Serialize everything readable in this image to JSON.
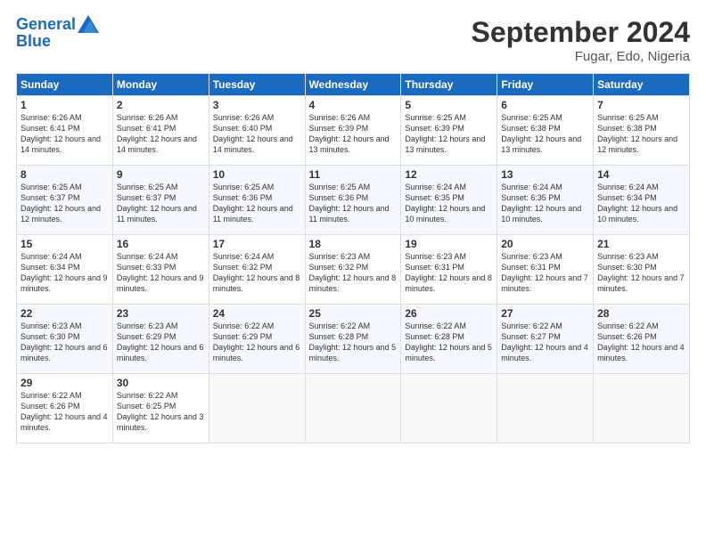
{
  "header": {
    "logo_line1": "General",
    "logo_line2": "Blue",
    "month": "September 2024",
    "location": "Fugar, Edo, Nigeria"
  },
  "weekdays": [
    "Sunday",
    "Monday",
    "Tuesday",
    "Wednesday",
    "Thursday",
    "Friday",
    "Saturday"
  ],
  "weeks": [
    [
      {
        "day": "1",
        "sunrise": "6:26 AM",
        "sunset": "6:41 PM",
        "daylight": "12 hours and 14 minutes."
      },
      {
        "day": "2",
        "sunrise": "6:26 AM",
        "sunset": "6:41 PM",
        "daylight": "12 hours and 14 minutes."
      },
      {
        "day": "3",
        "sunrise": "6:26 AM",
        "sunset": "6:40 PM",
        "daylight": "12 hours and 14 minutes."
      },
      {
        "day": "4",
        "sunrise": "6:26 AM",
        "sunset": "6:39 PM",
        "daylight": "12 hours and 13 minutes."
      },
      {
        "day": "5",
        "sunrise": "6:25 AM",
        "sunset": "6:39 PM",
        "daylight": "12 hours and 13 minutes."
      },
      {
        "day": "6",
        "sunrise": "6:25 AM",
        "sunset": "6:38 PM",
        "daylight": "12 hours and 13 minutes."
      },
      {
        "day": "7",
        "sunrise": "6:25 AM",
        "sunset": "6:38 PM",
        "daylight": "12 hours and 12 minutes."
      }
    ],
    [
      {
        "day": "8",
        "sunrise": "6:25 AM",
        "sunset": "6:37 PM",
        "daylight": "12 hours and 12 minutes."
      },
      {
        "day": "9",
        "sunrise": "6:25 AM",
        "sunset": "6:37 PM",
        "daylight": "12 hours and 11 minutes."
      },
      {
        "day": "10",
        "sunrise": "6:25 AM",
        "sunset": "6:36 PM",
        "daylight": "12 hours and 11 minutes."
      },
      {
        "day": "11",
        "sunrise": "6:25 AM",
        "sunset": "6:36 PM",
        "daylight": "12 hours and 11 minutes."
      },
      {
        "day": "12",
        "sunrise": "6:24 AM",
        "sunset": "6:35 PM",
        "daylight": "12 hours and 10 minutes."
      },
      {
        "day": "13",
        "sunrise": "6:24 AM",
        "sunset": "6:35 PM",
        "daylight": "12 hours and 10 minutes."
      },
      {
        "day": "14",
        "sunrise": "6:24 AM",
        "sunset": "6:34 PM",
        "daylight": "12 hours and 10 minutes."
      }
    ],
    [
      {
        "day": "15",
        "sunrise": "6:24 AM",
        "sunset": "6:34 PM",
        "daylight": "12 hours and 9 minutes."
      },
      {
        "day": "16",
        "sunrise": "6:24 AM",
        "sunset": "6:33 PM",
        "daylight": "12 hours and 9 minutes."
      },
      {
        "day": "17",
        "sunrise": "6:24 AM",
        "sunset": "6:32 PM",
        "daylight": "12 hours and 8 minutes."
      },
      {
        "day": "18",
        "sunrise": "6:23 AM",
        "sunset": "6:32 PM",
        "daylight": "12 hours and 8 minutes."
      },
      {
        "day": "19",
        "sunrise": "6:23 AM",
        "sunset": "6:31 PM",
        "daylight": "12 hours and 8 minutes."
      },
      {
        "day": "20",
        "sunrise": "6:23 AM",
        "sunset": "6:31 PM",
        "daylight": "12 hours and 7 minutes."
      },
      {
        "day": "21",
        "sunrise": "6:23 AM",
        "sunset": "6:30 PM",
        "daylight": "12 hours and 7 minutes."
      }
    ],
    [
      {
        "day": "22",
        "sunrise": "6:23 AM",
        "sunset": "6:30 PM",
        "daylight": "12 hours and 6 minutes."
      },
      {
        "day": "23",
        "sunrise": "6:23 AM",
        "sunset": "6:29 PM",
        "daylight": "12 hours and 6 minutes."
      },
      {
        "day": "24",
        "sunrise": "6:22 AM",
        "sunset": "6:29 PM",
        "daylight": "12 hours and 6 minutes."
      },
      {
        "day": "25",
        "sunrise": "6:22 AM",
        "sunset": "6:28 PM",
        "daylight": "12 hours and 5 minutes."
      },
      {
        "day": "26",
        "sunrise": "6:22 AM",
        "sunset": "6:28 PM",
        "daylight": "12 hours and 5 minutes."
      },
      {
        "day": "27",
        "sunrise": "6:22 AM",
        "sunset": "6:27 PM",
        "daylight": "12 hours and 4 minutes."
      },
      {
        "day": "28",
        "sunrise": "6:22 AM",
        "sunset": "6:26 PM",
        "daylight": "12 hours and 4 minutes."
      }
    ],
    [
      {
        "day": "29",
        "sunrise": "6:22 AM",
        "sunset": "6:26 PM",
        "daylight": "12 hours and 4 minutes."
      },
      {
        "day": "30",
        "sunrise": "6:22 AM",
        "sunset": "6:25 PM",
        "daylight": "12 hours and 3 minutes."
      },
      null,
      null,
      null,
      null,
      null
    ]
  ]
}
